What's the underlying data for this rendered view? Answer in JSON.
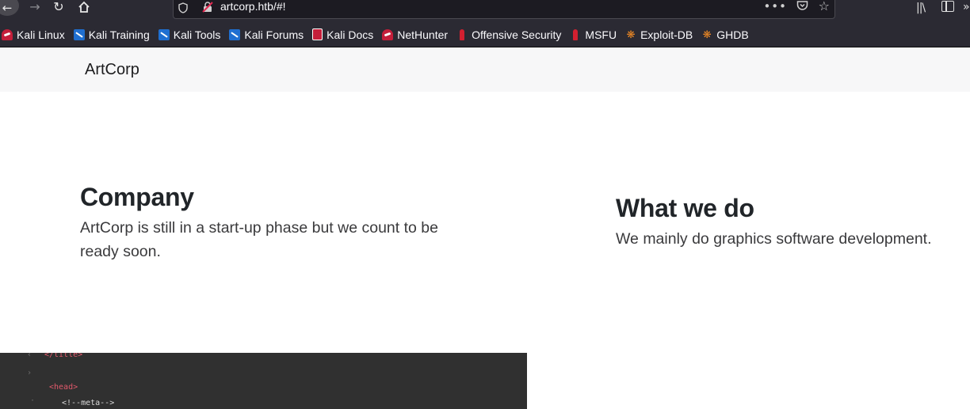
{
  "browser": {
    "url": "artcorp.htb/#!",
    "icons": {
      "back": "back-arrow-icon",
      "forward": "forward-arrow-icon",
      "reload": "reload-icon",
      "home": "home-icon",
      "shield": "tracking-shield-icon",
      "insecure": "insecure-lock-icon",
      "page_actions": "more-actions-icon",
      "pocket": "pocket-icon",
      "bookmark": "star-icon",
      "library": "library-icon",
      "sidebar": "sidebar-icon",
      "overflow": "overflow-menu-icon"
    }
  },
  "bookmarks": [
    {
      "label": "Kali Linux",
      "icon": "kali-linux-icon"
    },
    {
      "label": "Kali Training",
      "icon": "kali-training-icon"
    },
    {
      "label": "Kali Tools",
      "icon": "kali-tools-icon"
    },
    {
      "label": "Kali Forums",
      "icon": "kali-forums-icon"
    },
    {
      "label": "Kali Docs",
      "icon": "kali-docs-icon"
    },
    {
      "label": "NetHunter",
      "icon": "nethunter-icon"
    },
    {
      "label": "Offensive Security",
      "icon": "offensive-security-icon"
    },
    {
      "label": "MSFU",
      "icon": "msfu-icon"
    },
    {
      "label": "Exploit-DB",
      "icon": "exploit-db-icon"
    },
    {
      "label": "GHDB",
      "icon": "ghdb-icon"
    }
  ],
  "site": {
    "brand": "ArtCorp",
    "company": {
      "heading": "Company",
      "text": "ArtCorp is still in a start-up phase but we count to be ready soon."
    },
    "what_we_do": {
      "heading": "What we do",
      "text": "We mainly do graphics software development."
    },
    "code_snippet": [
      "</title>",
      "<head>",
      "<!--meta-->"
    ]
  },
  "colors": {
    "toolbar": "#2b2a33",
    "urlbar": "#1c1b22",
    "nav_bg": "#f7f7f8",
    "heading": "#212529",
    "code_bg": "#303030"
  }
}
